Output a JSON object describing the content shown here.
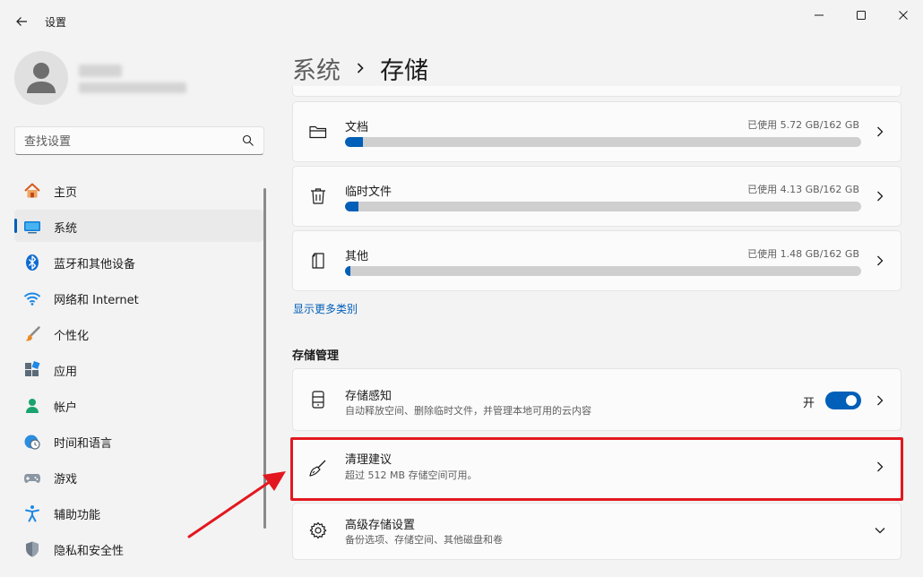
{
  "window": {
    "title": "设置"
  },
  "user": {
    "name": "",
    "email": ""
  },
  "search": {
    "placeholder": "查找设置"
  },
  "nav": {
    "items": [
      {
        "label": "主页",
        "icon": "home-icon"
      },
      {
        "label": "系统",
        "icon": "system-icon"
      },
      {
        "label": "蓝牙和其他设备",
        "icon": "bluetooth-icon"
      },
      {
        "label": "网络和 Internet",
        "icon": "wifi-icon"
      },
      {
        "label": "个性化",
        "icon": "brush-icon"
      },
      {
        "label": "应用",
        "icon": "apps-icon"
      },
      {
        "label": "帐户",
        "icon": "account-icon"
      },
      {
        "label": "时间和语言",
        "icon": "clock-globe-icon"
      },
      {
        "label": "游戏",
        "icon": "gamepad-icon"
      },
      {
        "label": "辅助功能",
        "icon": "accessibility-icon"
      },
      {
        "label": "隐私和安全性",
        "icon": "shield-icon"
      }
    ],
    "active_index": 1
  },
  "breadcrumb": {
    "parent": "系统",
    "current": "存储"
  },
  "categories": [
    {
      "title": "文档",
      "usage": "已使用 5.72 GB/162 GB",
      "used_gb": 5.72,
      "total_gb": 162,
      "icon": "folder-icon"
    },
    {
      "title": "临时文件",
      "usage": "已使用 4.13 GB/162 GB",
      "used_gb": 4.13,
      "total_gb": 162,
      "icon": "trash-icon"
    },
    {
      "title": "其他",
      "usage": "已使用 1.48 GB/162 GB",
      "used_gb": 1.48,
      "total_gb": 162,
      "icon": "document-icon"
    }
  ],
  "show_more_label": "显示更多类别",
  "management": {
    "section_title": "存储管理",
    "storage_sense": {
      "title": "存储感知",
      "subtitle": "自动释放空间、删除临时文件，并管理本地可用的云内容",
      "toggle_label": "开",
      "enabled": true
    },
    "cleanup": {
      "title": "清理建议",
      "subtitle": "超过 512 MB 存储空间可用。"
    },
    "advanced": {
      "title": "高级存储设置",
      "subtitle": "备份选项、存储空间、其他磁盘和卷"
    }
  },
  "colors": {
    "accent": "#005fb8",
    "highlight": "#e3171f",
    "background": "#f3f3f3",
    "card": "#fbfbfb"
  }
}
